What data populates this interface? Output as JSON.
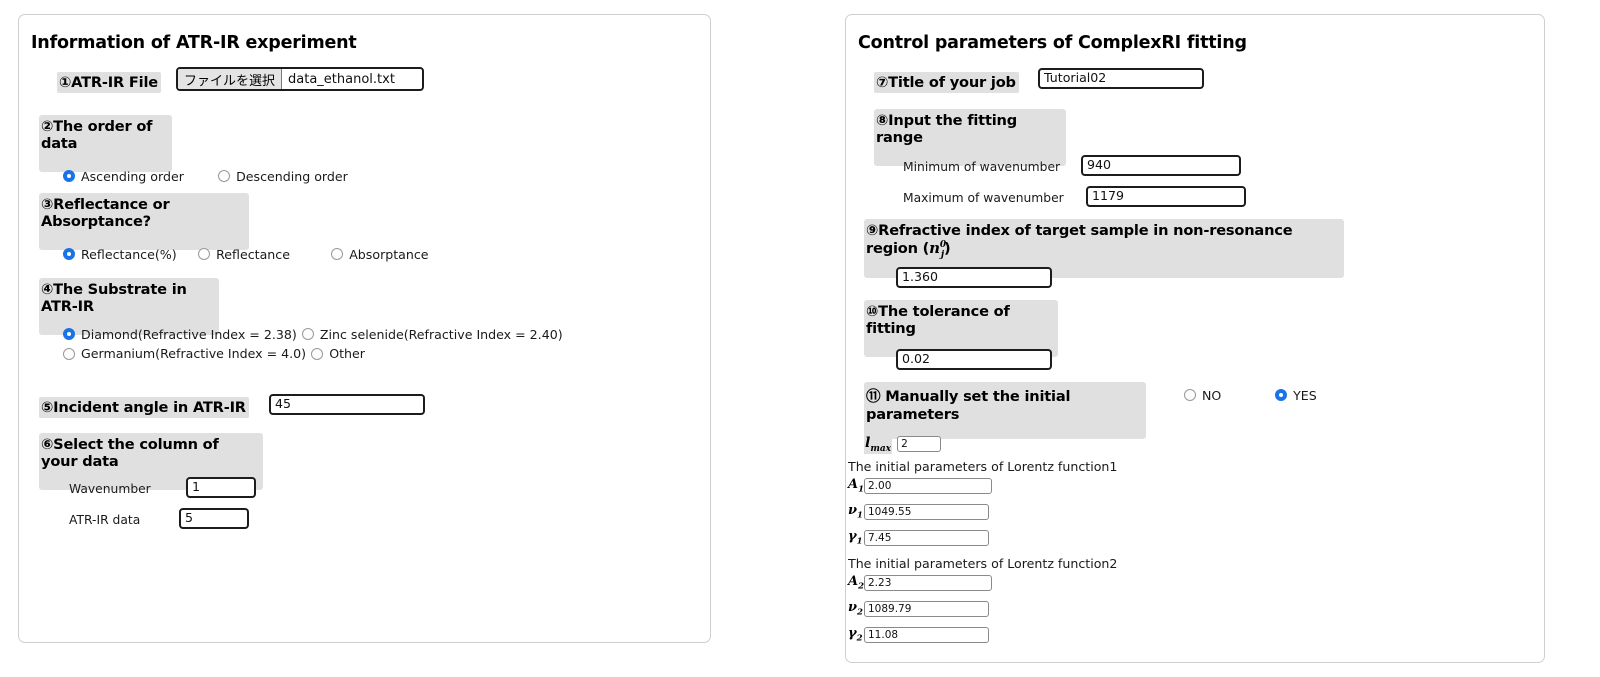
{
  "left_panel": {
    "title": "Information of ATR-IR experiment",
    "section1": {
      "label": "①ATR-IR File",
      "file_button": "ファイルを選択",
      "file_name": "data_ethanol.txt"
    },
    "section2": {
      "label": "②The order of data",
      "options": [
        {
          "label": "Ascending order",
          "checked": true
        },
        {
          "label": "Descending order",
          "checked": false
        }
      ]
    },
    "section3": {
      "label": "③Reflectance or Absorptance?",
      "options": [
        {
          "label": "Reflectance(%)",
          "checked": true
        },
        {
          "label": "Reflectance",
          "checked": false
        },
        {
          "label": "Absorptance",
          "checked": false
        }
      ]
    },
    "section4": {
      "label": "④The Substrate in ATR-IR",
      "options": [
        {
          "label": "Diamond(Refractive Index = 2.38)",
          "checked": true
        },
        {
          "label": "Zinc selenide(Refractive Index = 2.40)",
          "checked": false
        },
        {
          "label": "Germanium(Refractive Index = 4.0)",
          "checked": false
        },
        {
          "label": "Other",
          "checked": false
        }
      ]
    },
    "section5": {
      "label": "⑤Incident angle in ATR-IR",
      "value": "45"
    },
    "section6": {
      "label": "⑥Select the column of your data",
      "rows": [
        {
          "label": "Wavenumber",
          "value": "1"
        },
        {
          "label": "ATR-IR data",
          "value": "5"
        }
      ]
    }
  },
  "right_panel": {
    "title": "Control parameters of ComplexRI fitting",
    "section7": {
      "label": "⑦Title of your job",
      "value": "Tutorial02"
    },
    "section8": {
      "label": "⑧Input the fitting range",
      "rows": [
        {
          "label": "Minimum of wavenumber",
          "value": "940"
        },
        {
          "label": "Maximum of wavenumber",
          "value": "1179"
        }
      ]
    },
    "section9": {
      "label_prefix": "⑨Refractive index of target sample in non-resonance region (",
      "symbol": "n",
      "symbol_sub": "j",
      "symbol_sup": "0",
      "label_suffix": ")",
      "value": "1.360"
    },
    "section10": {
      "label": "⑩The tolerance of fitting",
      "value": "0.02"
    },
    "section11": {
      "label": "⑪ Manually set the initial parameters",
      "options": [
        {
          "label": "NO",
          "checked": false
        },
        {
          "label": "YES",
          "checked": true
        }
      ]
    },
    "lmax": {
      "symbol": "l",
      "symbol_sub": "max",
      "value": "2"
    },
    "lorentz_groups": [
      {
        "heading": "The initial parameters of Lorentz function1",
        "params": [
          {
            "symbol": "A",
            "sub": "1",
            "value": "2.00"
          },
          {
            "symbol": "ν",
            "sub": "1",
            "value": "1049.55"
          },
          {
            "symbol": "γ",
            "sub": "1",
            "value": "7.45"
          }
        ]
      },
      {
        "heading": "The initial parameters of Lorentz function2",
        "params": [
          {
            "symbol": "A",
            "sub": "2",
            "value": "2.23"
          },
          {
            "symbol": "ν",
            "sub": "2",
            "value": "1089.79"
          },
          {
            "symbol": "γ",
            "sub": "2",
            "value": "11.08"
          }
        ]
      }
    ]
  },
  "colors": {
    "accent": "#1a73e8",
    "label_highlight": "#e0e0e0",
    "panel_border": "#cfcfcf",
    "input_border": "#1c1c1c"
  }
}
